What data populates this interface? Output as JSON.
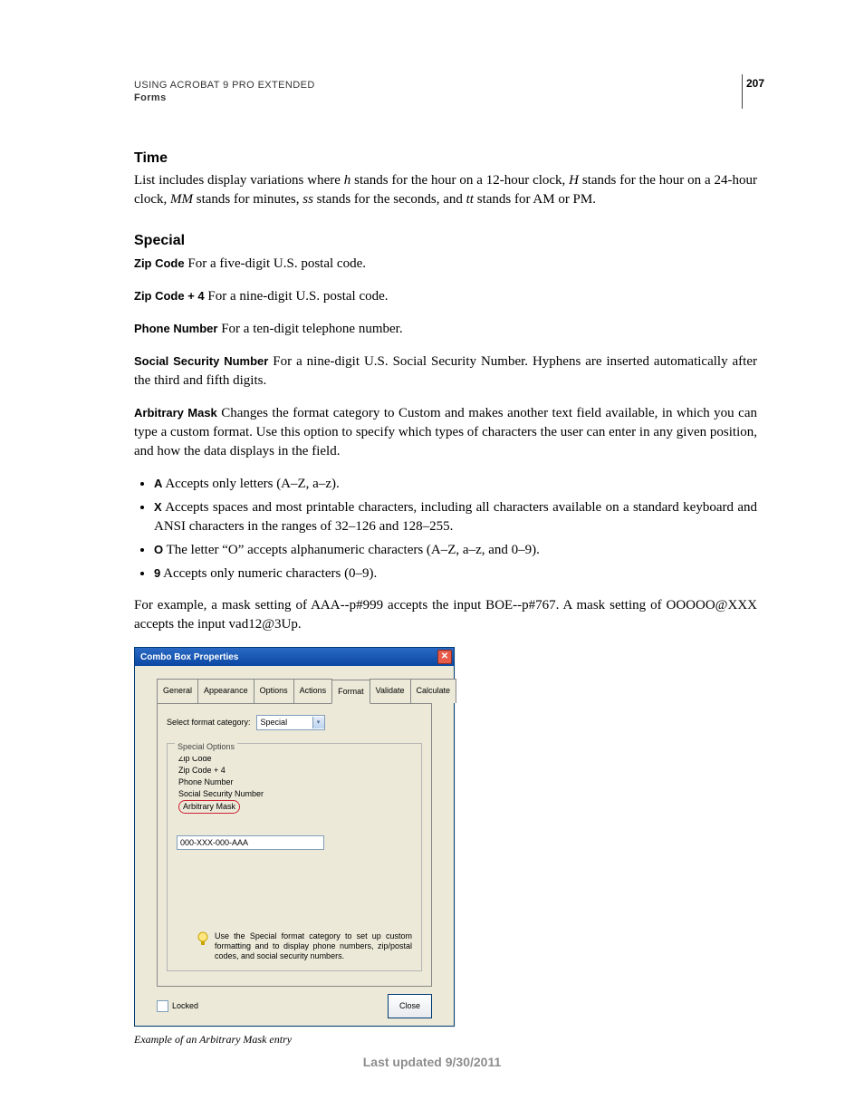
{
  "header": {
    "line1": "USING ACROBAT 9 PRO EXTENDED",
    "line2": "Forms",
    "page_number": "207"
  },
  "sections": {
    "time": {
      "heading": "Time",
      "body_pre": "List includes display variations where ",
      "h": "h",
      "body_1": " stands for the hour on a 12-hour clock, ",
      "H": "H",
      "body_2": " stands for the hour on a 24-hour clock, ",
      "MM": "MM",
      "body_3": " stands for minutes, ",
      "ss": "ss",
      "body_4": " stands for the seconds, and ",
      "tt": "tt",
      "body_5": " stands for AM or PM."
    },
    "special": {
      "heading": "Special",
      "zip": {
        "term": "Zip Code",
        "desc": "  For a five-digit U.S. postal code."
      },
      "zip4": {
        "term": "Zip Code + 4",
        "desc": "  For a nine-digit U.S. postal code."
      },
      "phone": {
        "term": "Phone Number",
        "desc": "  For a ten-digit telephone number."
      },
      "ssn": {
        "term": "Social Security Number",
        "desc": "  For a nine-digit U.S. Social Security Number. Hyphens are inserted automatically after the third and fifth digits."
      },
      "mask": {
        "term": "Arbitrary Mask",
        "desc": "  Changes the format category to Custom and makes another text field available, in which you can type a custom format. Use this option to specify which types of characters the user can enter in any given position, and how the data displays in the field."
      },
      "bullets": {
        "A": {
          "code": "A",
          "text": "  Accepts only letters (A–Z, a–z)."
        },
        "X": {
          "code": "X",
          "text": "  Accepts spaces and most printable characters, including all characters available on a standard keyboard and ANSI characters in the ranges of 32–126 and 128–255."
        },
        "O": {
          "code": "O",
          "text": "  The letter “O” accepts alphanumeric characters (A–Z, a–z, and 0–9)."
        },
        "Nine": {
          "code": "9",
          "text": "  Accepts only numeric characters (0–9)."
        }
      },
      "example": "For example, a mask setting of AAA--p#999 accepts the input BOE--p#767. A mask setting of OOOOO@XXX accepts the input vad12@3Up."
    }
  },
  "dialog": {
    "title": "Combo Box Properties",
    "tabs": [
      "General",
      "Appearance",
      "Options",
      "Actions",
      "Format",
      "Validate",
      "Calculate"
    ],
    "active_tab": "Format",
    "format_category_label": "Select format category:",
    "format_category_value": "Special",
    "group_legend": "Special Options",
    "options_list": [
      "Zip Code",
      "Zip Code + 4",
      "Phone Number",
      "Social Security Number",
      "Arbitrary Mask"
    ],
    "circled_option": "Arbitrary Mask",
    "mask_value": "000-XXX-000-AAA",
    "hint": "Use the Special format category to set up custom formatting and to display phone numbers, zip/postal codes, and social security numbers.",
    "locked_label": "Locked",
    "close_label": "Close"
  },
  "caption": "Example of an Arbitrary Mask entry",
  "footer": "Last updated 9/30/2011"
}
